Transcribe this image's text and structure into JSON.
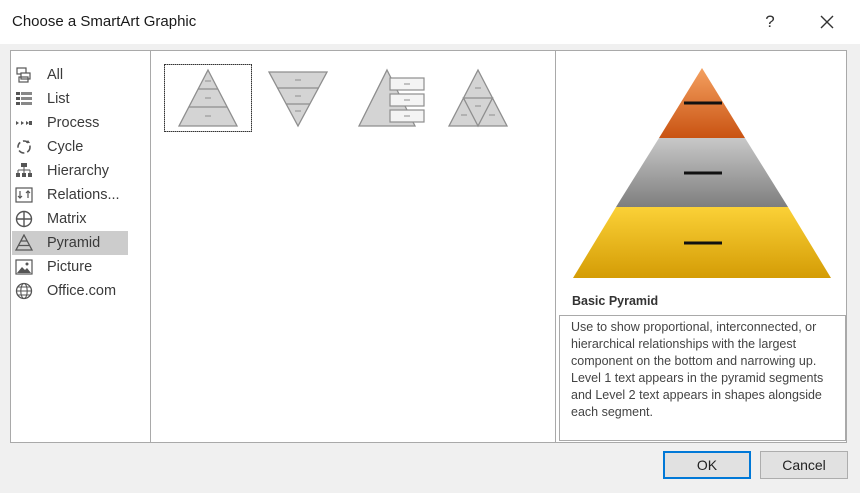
{
  "window": {
    "title": "Choose a SmartArt Graphic",
    "help_label": "?",
    "close_label": "✕"
  },
  "categories": [
    {
      "label": "All",
      "icon": "all-icon"
    },
    {
      "label": "List",
      "icon": "list-icon"
    },
    {
      "label": "Process",
      "icon": "process-icon"
    },
    {
      "label": "Cycle",
      "icon": "cycle-icon"
    },
    {
      "label": "Hierarchy",
      "icon": "hierarchy-icon"
    },
    {
      "label": "Relations...",
      "icon": "relationship-icon"
    },
    {
      "label": "Matrix",
      "icon": "matrix-icon"
    },
    {
      "label": "Pyramid",
      "icon": "pyramid-icon",
      "selected": true
    },
    {
      "label": "Picture",
      "icon": "picture-icon"
    },
    {
      "label": "Office.com",
      "icon": "globe-icon"
    }
  ],
  "gallery": {
    "layouts": [
      {
        "name": "Basic Pyramid",
        "selected": true
      },
      {
        "name": "Inverted Pyramid"
      },
      {
        "name": "Pyramid List"
      },
      {
        "name": "Segmented Pyramid"
      }
    ]
  },
  "preview": {
    "title": "Basic Pyramid",
    "description": "Use to show proportional, interconnected, or hierarchical relationships with the largest component on the bottom and narrowing up. Level 1 text appears in the pyramid segments and Level 2 text appears in shapes alongside each segment.",
    "colors": {
      "top": "#e0712c",
      "middle": "#9a9a9a",
      "bottom": "#f2bb1b"
    }
  },
  "buttons": {
    "ok_label": "OK",
    "cancel_label": "Cancel"
  }
}
